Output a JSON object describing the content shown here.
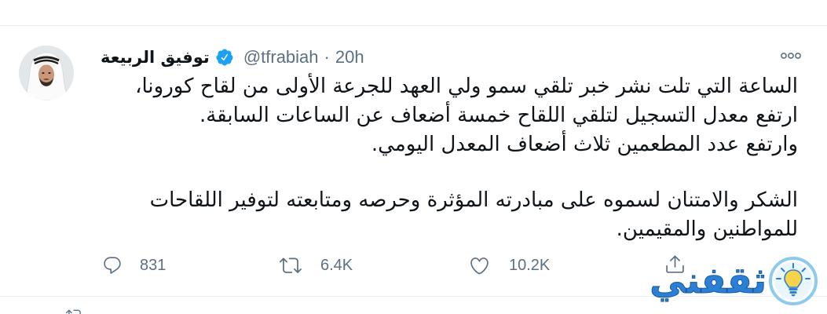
{
  "colors": {
    "text": "#0f1419",
    "secondary": "#5b7083",
    "verified": "#1da1f2",
    "divider": "#e6ecf0",
    "watermark": "#2b7fd4"
  },
  "tweet": {
    "author": {
      "avatar_icon": "profile-photo-icon",
      "name": "توفيق الربيعة",
      "verified_icon": "verified-badge-icon",
      "handle": "@tfrabiah",
      "separator": "·",
      "time": "20h"
    },
    "more_icon": "more-icon",
    "paragraphs": [
      {
        "lines": [
          "الساعة التي تلت نشر خبر تلقي سمو ولي العهد للجرعة الأولى من لقاح كورونا،",
          "ارتفع معدل التسجيل لتلقي اللقاح خمسة أضعاف عن الساعات السابقة.",
          "وارتفع عدد المطعمين ثلاث أضعاف المعدل اليومي."
        ]
      },
      {
        "lines": [
          "الشكر والامتنان لسموه على مبادرته المؤثرة وحرصه ومتابعته لتوفير اللقاحات",
          "للمواطنين والمقيمين."
        ]
      }
    ],
    "actions": {
      "reply": {
        "icon": "reply-icon",
        "count": "831"
      },
      "retweet": {
        "icon": "retweet-icon",
        "count": "6.4K"
      },
      "like": {
        "icon": "heart-icon",
        "count": "10.2K"
      },
      "share": {
        "icon": "share-icon"
      }
    }
  },
  "next_item": {
    "icon": "retweet-icon"
  },
  "watermark": {
    "text": "ثقفني",
    "icon": "lightbulb-icon"
  }
}
